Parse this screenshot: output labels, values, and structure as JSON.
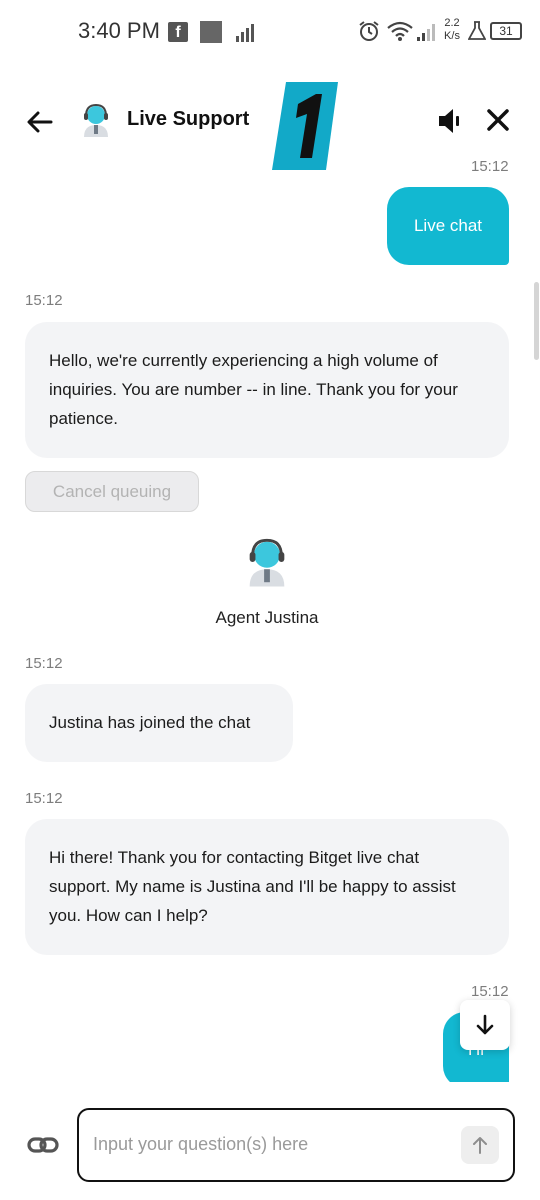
{
  "status_bar": {
    "time": "3:40 PM",
    "facebook_glyph": "f",
    "net_speed_value": "2.2",
    "net_speed_unit": "K/s",
    "battery": "31",
    "icons": [
      "facebook-icon",
      "square-icon",
      "chart-icon",
      "alarm-icon",
      "wifi-icon",
      "signal-icon",
      "flask-icon",
      "battery-icon"
    ]
  },
  "header": {
    "title": "Live Support",
    "icons": [
      "back-arrow-icon",
      "agent-avatar-icon",
      "sound-on-icon",
      "close-icon"
    ]
  },
  "colors": {
    "accent": "#12b8d1",
    "incoming_bubble": "#f3f4f6"
  },
  "messages": [
    {
      "side": "out",
      "time": "15:12",
      "text": "Live chat"
    },
    {
      "side": "in",
      "time": "15:12",
      "text": "Hello, we're currently experiencing a high volume of inquiries. You are number -- in line. Thank you for your patience."
    },
    {
      "side": "in",
      "time": "15:12",
      "text": "Justina has joined the chat"
    },
    {
      "side": "in",
      "time": "15:12",
      "text": "Hi there! Thank you for contacting Bitget live chat support. My name is Justina and I'll be happy to assist you. How can I help?"
    },
    {
      "side": "out",
      "time": "15:12",
      "text": "Hi"
    }
  ],
  "cancel_queue_label": "Cancel queuing",
  "agent": {
    "name": "Agent Justina"
  },
  "input": {
    "placeholder": "Input your question(s) here",
    "value": ""
  }
}
